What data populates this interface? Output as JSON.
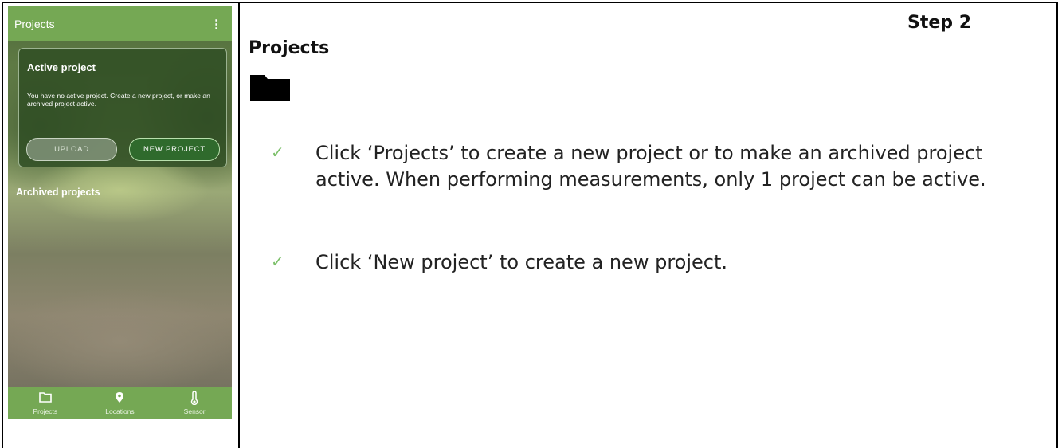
{
  "phone": {
    "app_title": "Projects",
    "menu_glyph": "⋮",
    "active_card": {
      "title": "Active project",
      "text": "You have no active project. Create a new project, or make an archived project active.",
      "upload_label": "UPLOAD",
      "new_project_label": "NEW PROJECT"
    },
    "archived_title": "Archived projects",
    "nav": [
      {
        "label": "Projects",
        "icon": "folder-icon"
      },
      {
        "label": "Locations",
        "icon": "location-pin-icon"
      },
      {
        "label": "Sensor",
        "icon": "thermometer-icon"
      }
    ],
    "colors": {
      "bar": "#75a854",
      "card": "#304e24",
      "accent_button": "#2f6a2c"
    }
  },
  "instructions": {
    "step": "Step 2",
    "heading": "Projects",
    "heading_icon": "folder-icon",
    "check_glyph": "✓",
    "check_color": "#7cc06a",
    "bullets": [
      "Click ‘Projects’ to create a new project or to make an archived project active. When performing measurements, only 1 project can be active.",
      "Click ‘New project’ to create a new project."
    ]
  }
}
